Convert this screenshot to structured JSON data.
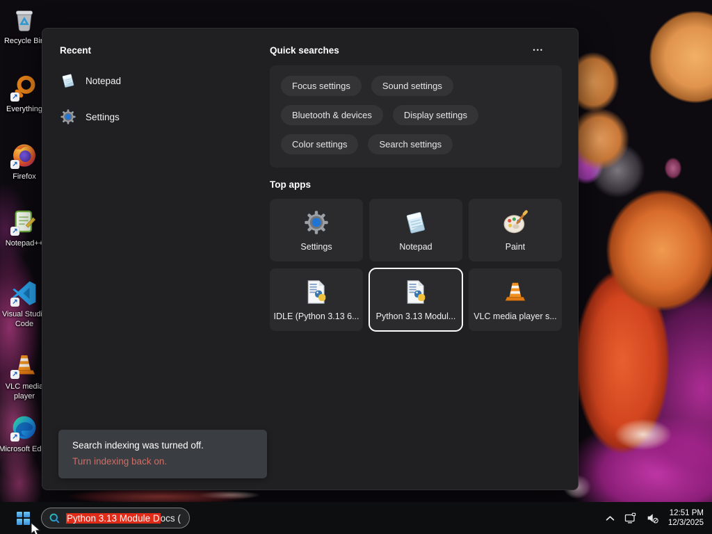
{
  "desktop": {
    "icons": [
      {
        "id": "recycle-bin",
        "label": "Recycle Bin"
      },
      {
        "id": "everything",
        "label": "Everything"
      },
      {
        "id": "firefox",
        "label": "Firefox"
      },
      {
        "id": "notepad-plus-plus",
        "label": "Notepad++"
      },
      {
        "id": "vscode",
        "label": "Visual Studio Code"
      },
      {
        "id": "vlc",
        "label": "VLC media player"
      },
      {
        "id": "edge",
        "label": "Microsoft Edge"
      }
    ]
  },
  "panel": {
    "recent": {
      "title": "Recent",
      "items": [
        {
          "label": "Notepad",
          "icon": "notepad-icon"
        },
        {
          "label": "Settings",
          "icon": "gear-icon"
        }
      ]
    },
    "quick_searches": {
      "title": "Quick searches",
      "more_icon": "•••",
      "pills": [
        "Focus settings",
        "Sound settings",
        "Bluetooth & devices",
        "Display settings",
        "Color settings",
        "Search settings"
      ]
    },
    "top_apps": {
      "title": "Top apps",
      "items": [
        {
          "label": "Settings",
          "icon": "gear-icon",
          "selected": false
        },
        {
          "label": "Notepad",
          "icon": "notepad-icon",
          "selected": false
        },
        {
          "label": "Paint",
          "icon": "paint-icon",
          "selected": false
        },
        {
          "label": "IDLE (Python 3.13 6...",
          "icon": "python-doc-icon",
          "selected": false
        },
        {
          "label": "Python 3.13 Modul...",
          "icon": "python-doc-icon",
          "selected": true
        },
        {
          "label": "VLC media player s...",
          "icon": "vlc-cone-icon",
          "selected": false
        }
      ]
    },
    "notification": {
      "message": "Search indexing was turned off.",
      "action": "Turn indexing back on."
    }
  },
  "taskbar": {
    "search": {
      "selected_text": "Python 3.13 Module D",
      "tail_text": "ocs ("
    },
    "clock": {
      "time": "12:51 PM",
      "date": "12/3/2025"
    }
  },
  "colors": {
    "selection_red": "#e02b18",
    "notification_link": "#cf6e66",
    "panel_bg": "#202022",
    "taskbar_bg": "#0d0e10",
    "accent_blue": "#3a8ed8"
  }
}
